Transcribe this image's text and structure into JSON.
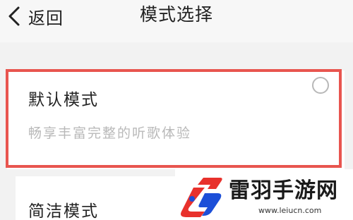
{
  "header": {
    "back_label": "返回",
    "title": "模式选择"
  },
  "options": [
    {
      "title": "默认模式",
      "description": "畅享丰富完整的听歌体验",
      "selected": false
    },
    {
      "title": "简洁模式"
    }
  ],
  "watermark": {
    "name": "雷羽手游网",
    "url": "www.leiucn.com"
  },
  "colors": {
    "highlight_border": "#e8554f",
    "background": "#f2f2f2",
    "card": "#ffffff",
    "description_text": "#b9b9b9",
    "logo_red": "#e8312c",
    "logo_blue": "#1c4fd8"
  }
}
